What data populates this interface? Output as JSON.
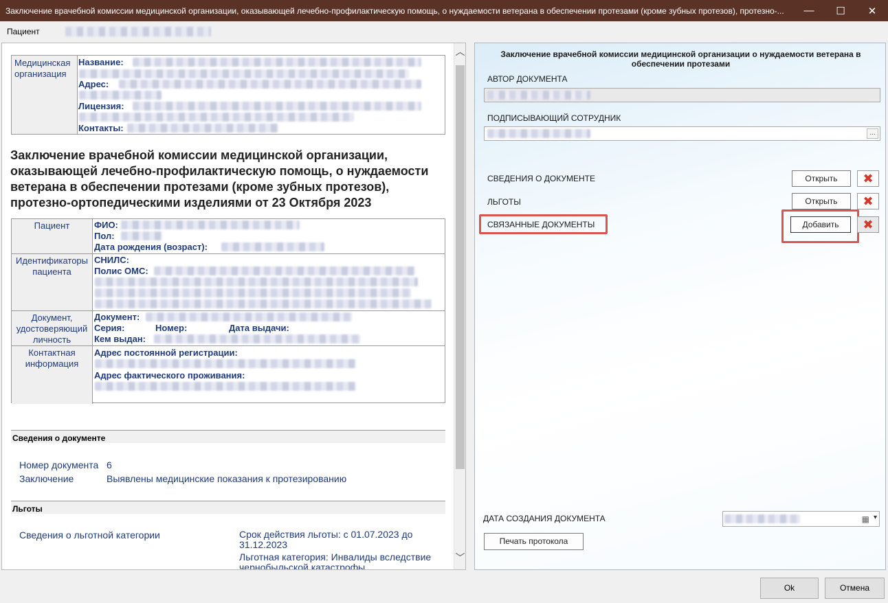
{
  "window": {
    "title": "Заключение врачебной комиссии медицинской организации, оказывающей лечебно-профилактическую помощь, о нуждаемости ветерана в обеспечении протезами (кроме зубных протезов), протезно-...",
    "minimize": "—",
    "maximize": "☐",
    "close": "✕"
  },
  "patient_bar": {
    "label": "Пациент"
  },
  "document": {
    "org": {
      "label": "Медицинская организация",
      "name_label": "Название:",
      "address_label": "Адрес:",
      "license_label": "Лицензия:",
      "contacts_label": "Контакты:"
    },
    "title": "Заключение врачебной комиссии медицинской организации, оказывающей лечебно-профилактическую помощь, о нуждаемости ветерана в обеспечении протезами (кроме зубных протезов), протезно-ортопедическими изделиями от 23 Октября 2023",
    "patient": {
      "label": "Пациент",
      "fio_label": "ФИО:",
      "sex_label": "Пол:",
      "birth_label": "Дата рождения (возраст):"
    },
    "identifiers": {
      "label": "Идентификаторы пациента",
      "snils_label": "СНИЛС:",
      "oms_label": "Полис ОМС:"
    },
    "identity_doc": {
      "label": "Документ, удостоверяющий личность",
      "doc_label": "Документ:",
      "series_label": "Серия:",
      "number_label": "Номер:",
      "issue_date_label": "Дата выдачи:",
      "issued_by_label": "Кем выдан:"
    },
    "contacts": {
      "label": "Контактная информация",
      "reg_address_label": "Адрес постоянной регистрации:",
      "fact_address_label": "Адрес фактического проживания:"
    },
    "doc_info": {
      "header": "Сведения о документе",
      "number_label": "Номер документа",
      "number_value": "6",
      "conclusion_label": "Заключение",
      "conclusion_value": "Выявлены медицинские показания к протезированию"
    },
    "benefits": {
      "header": "Льготы",
      "category_label": "Сведения о льготной категории",
      "period": "Срок действия льготы: с 01.07.2023 до 31.12.2023",
      "category": "Льготная категория: Инвалиды вследствие чернобыльской катастрофы"
    }
  },
  "form": {
    "title": "Заключение врачебной комиссии медицинской организации о нуждаемости ветерана в обеспечении протезами",
    "author_label": "АВТОР ДОКУМЕНТА",
    "signer_label": "ПОДПИСЫВАЮЩИЙ СОТРУДНИК",
    "signer_button": "...",
    "rows": [
      {
        "label": "СВЕДЕНИЯ О ДОКУМЕНТЕ",
        "button": "Открыть"
      },
      {
        "label": "ЛЬГОТЫ",
        "button": "Открыть"
      },
      {
        "label": "СВЯЗАННЫЕ ДОКУМЕНТЫ",
        "button": "Добавить"
      }
    ],
    "delete_glyph": "✖",
    "created_label": "ДАТА СОЗДАНИЯ ДОКУМЕНТА",
    "calendar_glyph": "▦",
    "dropdown_glyph": "▾",
    "print_button": "Печать протокола"
  },
  "footer": {
    "ok": "Ok",
    "cancel": "Отмена"
  },
  "colors": {
    "titlebar": "#5a3226",
    "highlight": "#d9534f",
    "link_text": "#1f3a7a"
  }
}
